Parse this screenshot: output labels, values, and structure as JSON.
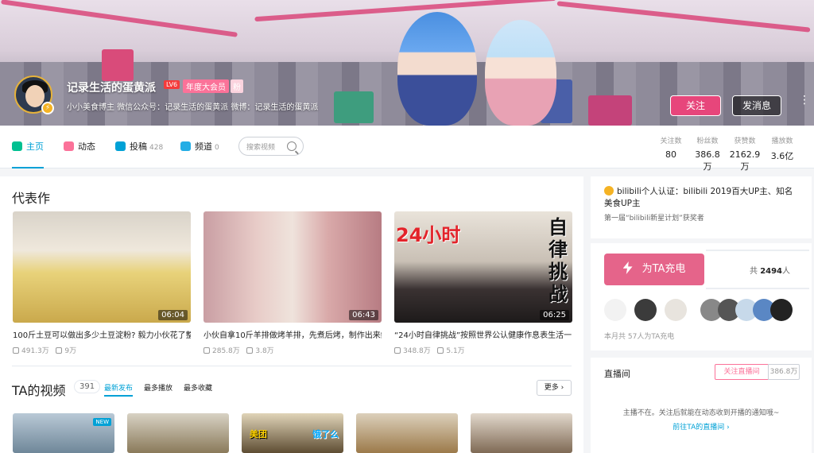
{
  "header": {
    "username": "记录生活的蛋黄派",
    "level": "LV6",
    "vip_label": "年度大会员",
    "fan_label": "粉",
    "signature": "小小美食博主 微信公众号：记录生活的蛋黄派 微博：记录生活的蛋黄派",
    "follow_label": "关注",
    "message_label": "发消息",
    "more_label": "⋮",
    "vip_icon": "⚡"
  },
  "nav": {
    "tabs": [
      {
        "label": "主页",
        "count": "",
        "icon": "home-icon",
        "color": "#00c091"
      },
      {
        "label": "动态",
        "count": "",
        "icon": "dynamic-icon",
        "color": "#fb7299"
      },
      {
        "label": "投稿",
        "count": "428",
        "icon": "upload-icon",
        "color": "#00a1d6"
      },
      {
        "label": "频道",
        "count": "0",
        "icon": "channel-icon",
        "color": "#23ade5"
      }
    ],
    "search_placeholder": "搜索视频",
    "stats": [
      {
        "label": "关注数",
        "value": "80"
      },
      {
        "label": "粉丝数",
        "value": "386.8万"
      },
      {
        "label": "获赞数",
        "value": "2162.9万"
      },
      {
        "label": "播放数",
        "value": "3.6亿"
      }
    ]
  },
  "masterpiece": {
    "title": "代表作",
    "videos": [
      {
        "title": "100斤土豆可以做出多少土豆淀粉? 毅力小伙花了整",
        "duration": "06:04",
        "views": "491.3万",
        "comments": "9万",
        "overlay": ""
      },
      {
        "title": "小伙自拿10斤羊排做烤羊排，先煮后烤，制作出来鲜",
        "duration": "06:43",
        "views": "285.8万",
        "comments": "3.8万",
        "overlay": ""
      },
      {
        "title": "“24小时自律挑战”按照世界公认健康作息表生活一",
        "duration": "06:25",
        "views": "348.8万",
        "comments": "5.1万",
        "overlay": "24小时",
        "overlay2": "自律挑战"
      }
    ]
  },
  "videos": {
    "title": "TA的视频",
    "count": "391",
    "sort": [
      "最新发布",
      "最多播放",
      "最多收藏"
    ],
    "more_label": "更多 ›",
    "new_badge": "NEW",
    "card_labels": [
      "",
      "",
      "美团",
      "饿了么",
      ""
    ]
  },
  "cert": {
    "text": "bilibili个人认证：bilibili 2019百大UP主、知名美食UP主",
    "sub": "第一届“bilibili新星计划”获奖者"
  },
  "charge": {
    "button_label": "为TA充电",
    "total_prefix": "共 ",
    "total": "2494",
    "total_suffix": "人",
    "month_text": "本月共 57人为TA充电"
  },
  "live": {
    "title": "直播间",
    "follow_label": "关注直播间",
    "follower_count": "386.8万",
    "message": "主播不在。关注后就能在动态收到开播的通知哦~",
    "link": "前往TA的直播间 ›"
  },
  "colors": {
    "accent": "#00a1d6",
    "pink": "#fb7299"
  }
}
